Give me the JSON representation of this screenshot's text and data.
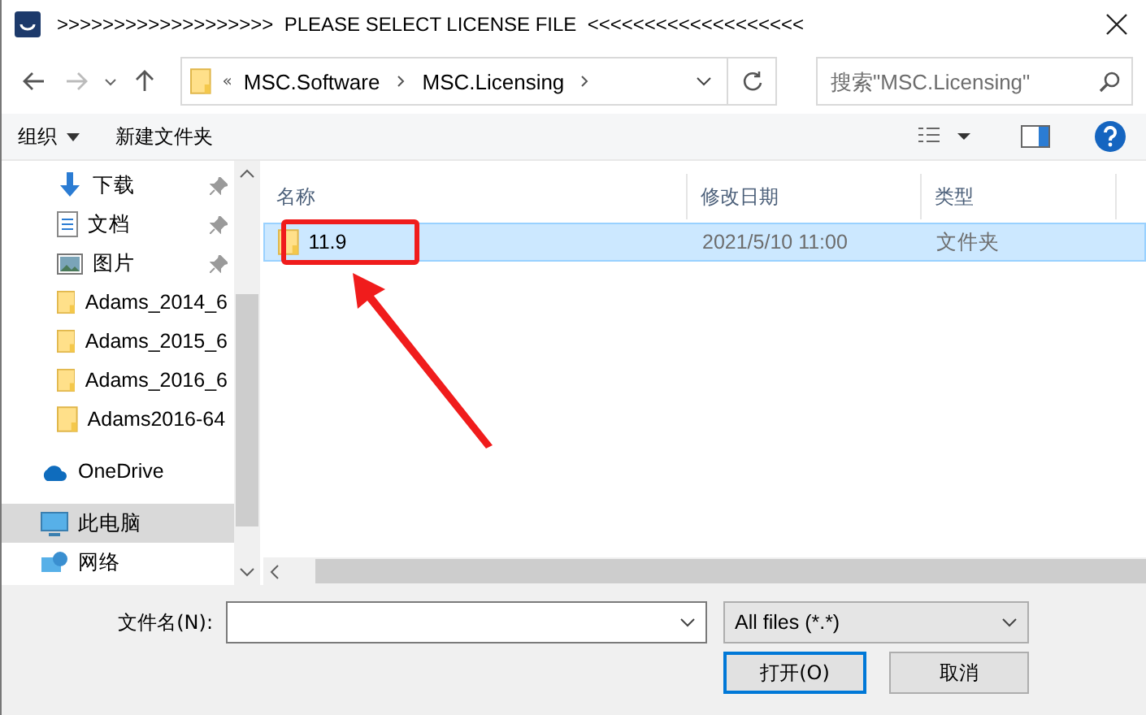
{
  "window": {
    "title": ">>>>>>>>>>>>>>>>>>>  PLEASE SELECT LICENSE FILE  <<<<<<<<<<<<<<<<<<<"
  },
  "address": {
    "overflow": "«",
    "crumbs": [
      "MSC.Software",
      "MSC.Licensing"
    ]
  },
  "search": {
    "placeholder": "搜索\"MSC.Licensing\""
  },
  "toolbar": {
    "organize": "组织",
    "new_folder": "新建文件夹"
  },
  "sidebar": {
    "items": [
      {
        "label": "下载",
        "kind": "download",
        "pinned": true,
        "selected": false
      },
      {
        "label": "文档",
        "kind": "document",
        "pinned": true,
        "selected": false
      },
      {
        "label": "图片",
        "kind": "picture",
        "pinned": true,
        "selected": false
      },
      {
        "label": "Adams_2014_6",
        "kind": "folder",
        "pinned": false,
        "selected": false
      },
      {
        "label": "Adams_2015_6",
        "kind": "folder",
        "pinned": false,
        "selected": false
      },
      {
        "label": "Adams_2016_6",
        "kind": "folder",
        "pinned": false,
        "selected": false
      },
      {
        "label": "Adams2016-64",
        "kind": "folder",
        "pinned": false,
        "selected": false
      },
      {
        "label": "OneDrive",
        "kind": "cloud",
        "pinned": false,
        "selected": false
      },
      {
        "label": "此电脑",
        "kind": "pc",
        "pinned": false,
        "selected": true
      },
      {
        "label": "网络",
        "kind": "network",
        "pinned": false,
        "selected": false
      }
    ]
  },
  "table": {
    "columns": [
      "名称",
      "修改日期",
      "类型"
    ],
    "rows": [
      {
        "name": "11.9",
        "date": "2021/5/10 11:00",
        "type": "文件夹",
        "selected": true,
        "highlighted": true
      }
    ]
  },
  "footer": {
    "filename_label": "文件名(N):",
    "filter": "All files (*.*)",
    "buttons": [
      "打开(O)",
      "取消"
    ]
  }
}
